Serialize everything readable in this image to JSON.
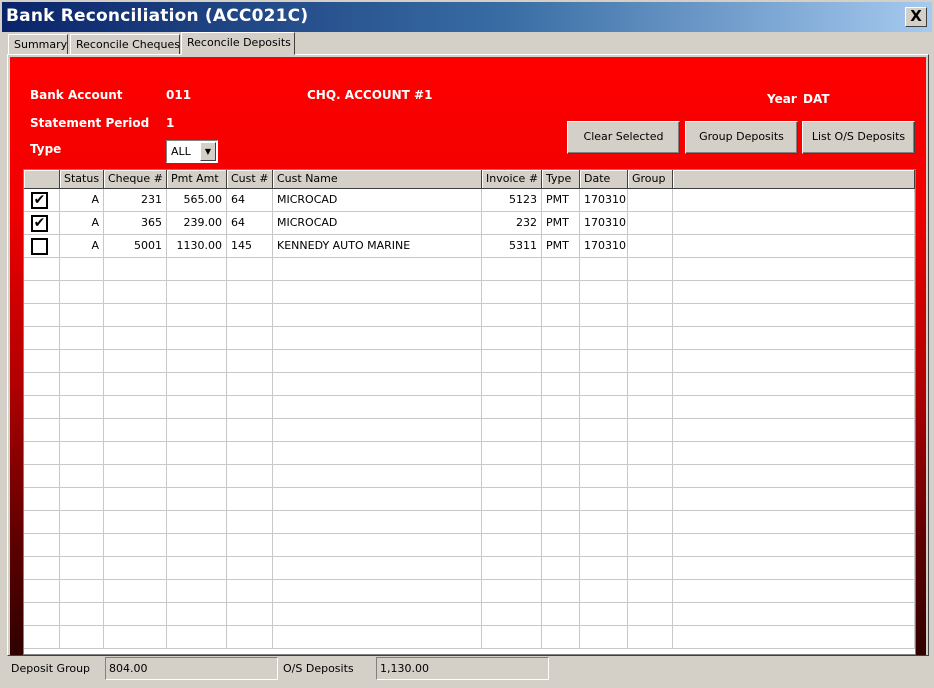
{
  "window": {
    "title": "Bank Reconciliation (ACC021C)",
    "close_label": "X"
  },
  "tabs": [
    {
      "label": "Summary",
      "active": false
    },
    {
      "label": "Reconcile Cheques",
      "active": false
    },
    {
      "label": "Reconcile Deposits",
      "active": true
    }
  ],
  "header": {
    "bank_account_label": "Bank Account",
    "bank_account_value": "011",
    "account_name": "CHQ. ACCOUNT #1",
    "year_label": "Year",
    "year_value": "DAT",
    "statement_period_label": "Statement Period",
    "statement_period_value": "1",
    "type_label": "Type",
    "type_value": "ALL"
  },
  "buttons": {
    "clear_selected": "Clear Selected",
    "group_deposits": "Group Deposits",
    "list_os_deposits": "List O/S Deposits"
  },
  "grid": {
    "columns": [
      "",
      "Status",
      "Cheque #",
      "Pmt Amt",
      "Cust #",
      "Cust Name",
      "Invoice #",
      "Type",
      "Date",
      "Group"
    ],
    "rows": [
      {
        "checked": true,
        "status": "A",
        "cheque": "231",
        "pmt_amt": "565.00",
        "cust": "64",
        "cust_name": "MICROCAD",
        "invoice": "5123",
        "type": "PMT",
        "date": "170310",
        "group": ""
      },
      {
        "checked": true,
        "status": "A",
        "cheque": "365",
        "pmt_amt": "239.00",
        "cust": "64",
        "cust_name": "MICROCAD",
        "invoice": "232",
        "type": "PMT",
        "date": "170310",
        "group": ""
      },
      {
        "checked": false,
        "status": "A",
        "cheque": "5001",
        "pmt_amt": "1130.00",
        "cust": "145",
        "cust_name": "KENNEDY AUTO MARINE",
        "invoice": "5311",
        "type": "PMT",
        "date": "170310",
        "group": ""
      }
    ],
    "check_glyph": "✔"
  },
  "status": {
    "deposit_group_label": "Deposit Group",
    "deposit_group_value": "804.00",
    "os_deposits_label": "O/S Deposits",
    "os_deposits_value": "1,130.00"
  },
  "colors": {
    "panel_red": "#ff0000",
    "title_blue": "#0a246a"
  }
}
